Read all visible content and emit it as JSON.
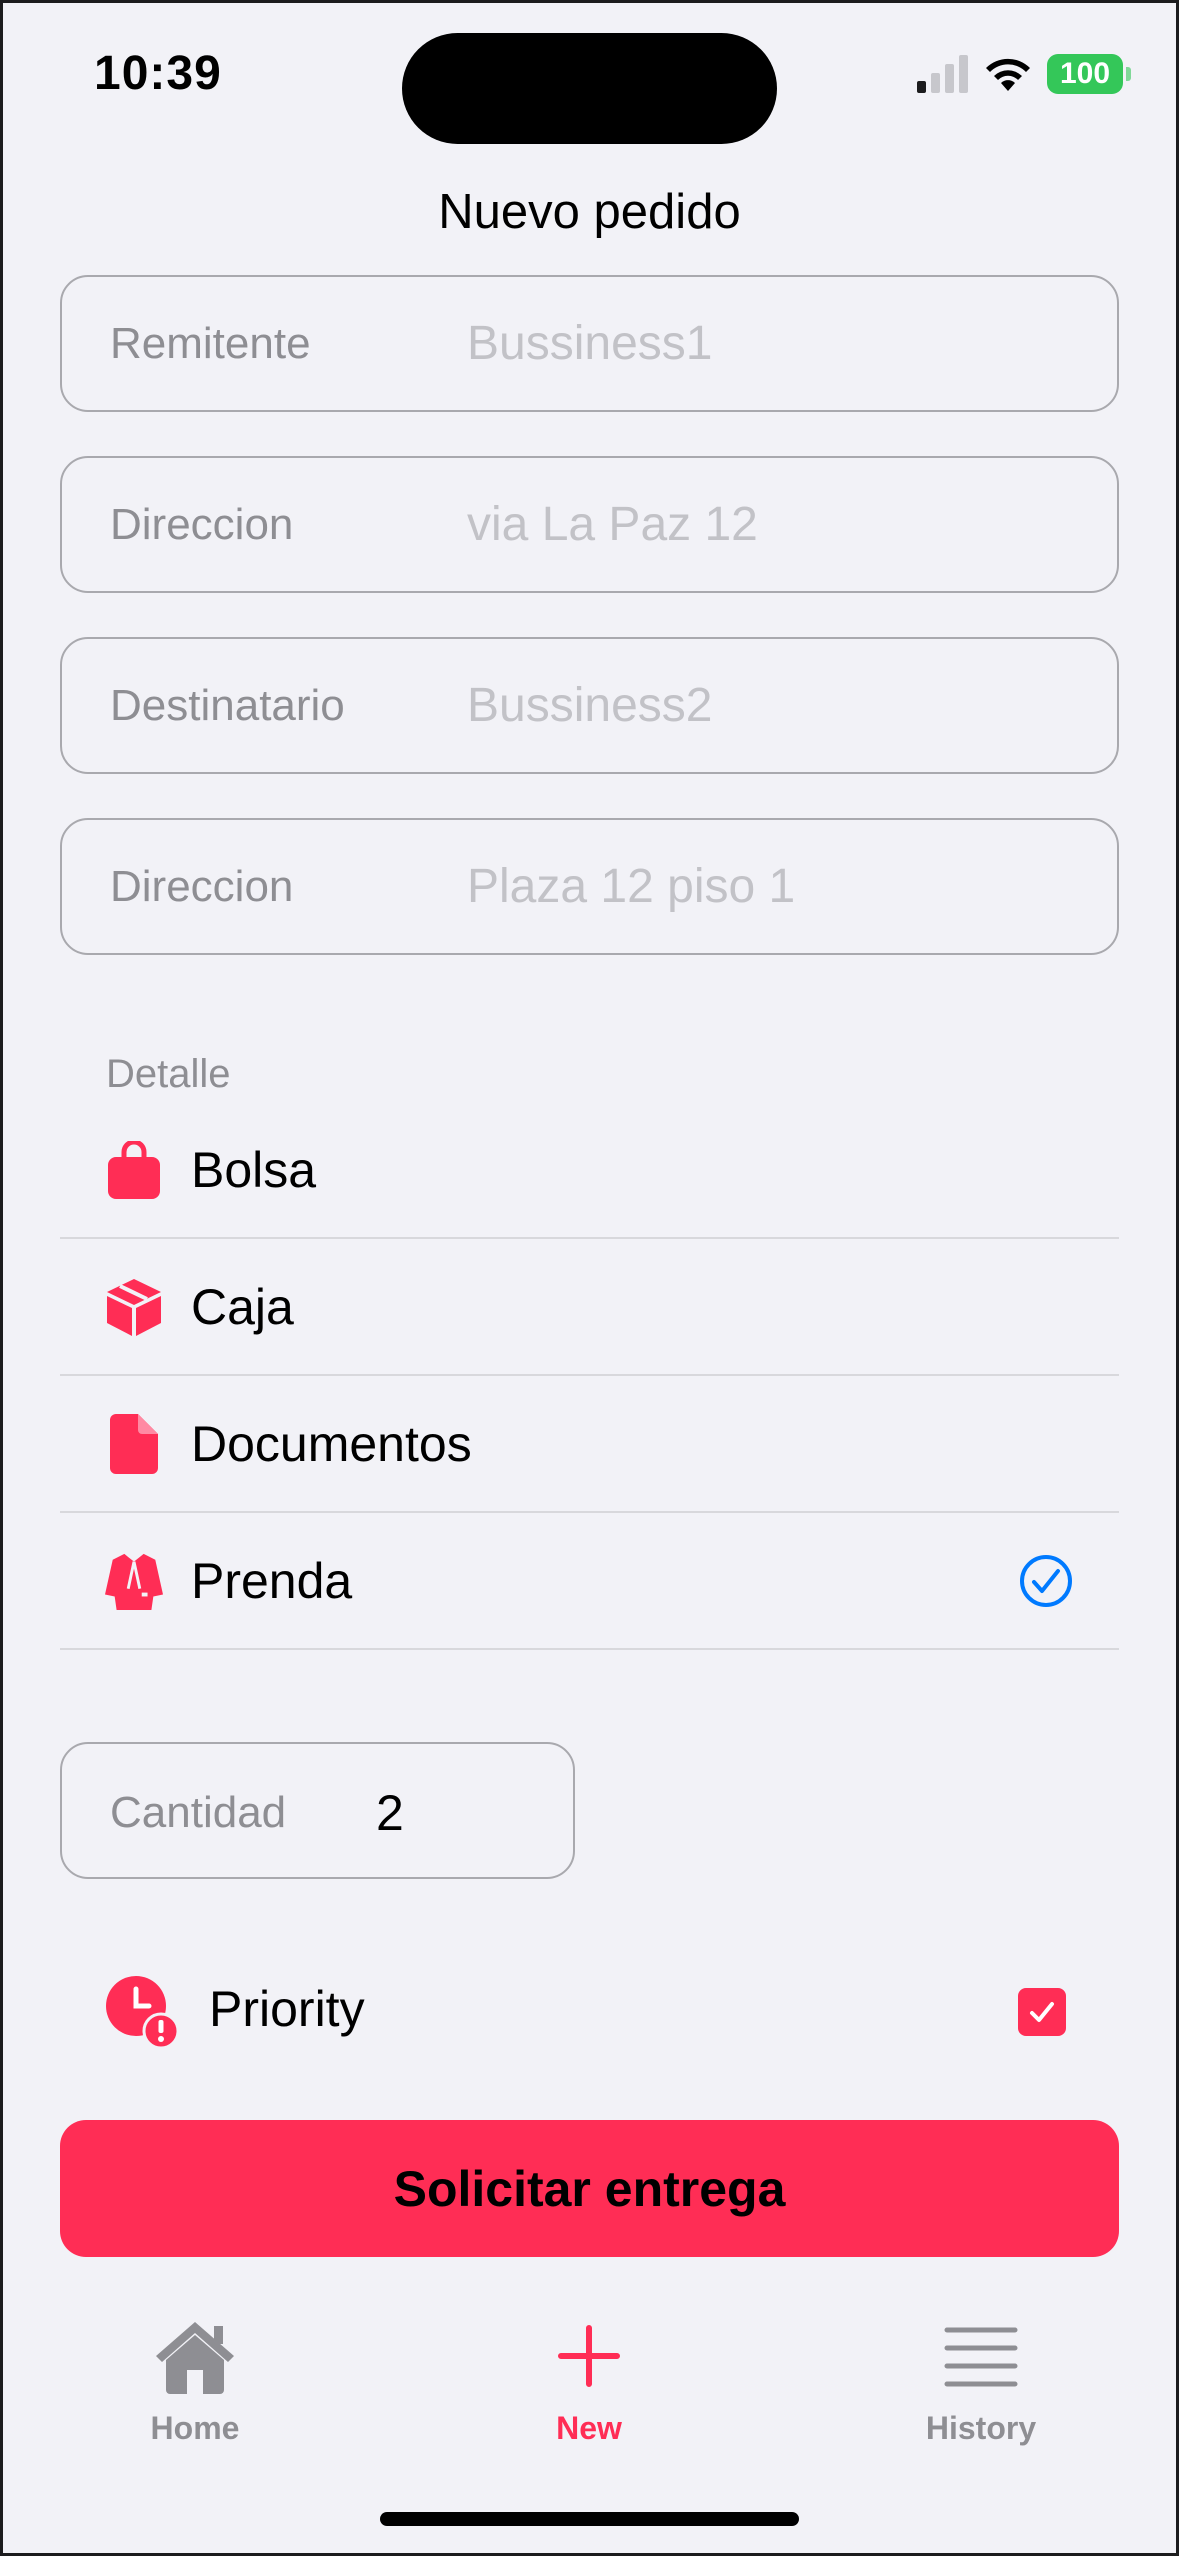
{
  "status_bar": {
    "time": "10:39",
    "battery": "100"
  },
  "nav": {
    "title": "Nuevo pedido"
  },
  "form": {
    "fields": [
      {
        "label": "Remitente",
        "placeholder": "Bussiness1"
      },
      {
        "label": "Direccion",
        "placeholder": "via La Paz 12"
      },
      {
        "label": "Destinatario",
        "placeholder": "Bussiness2"
      },
      {
        "label": "Direccion",
        "placeholder": "Plaza 12 piso 1"
      }
    ]
  },
  "detail": {
    "header": "Detalle",
    "items": [
      {
        "label": "Bolsa",
        "icon": "bag-icon",
        "selected": false
      },
      {
        "label": "Caja",
        "icon": "box-icon",
        "selected": false
      },
      {
        "label": "Documentos",
        "icon": "document-icon",
        "selected": false
      },
      {
        "label": "Prenda",
        "icon": "jacket-icon",
        "selected": true
      }
    ]
  },
  "quantity": {
    "label": "Cantidad",
    "value": "2"
  },
  "priority": {
    "label": "Priority",
    "checked": true
  },
  "submit": {
    "label": "Solicitar entrega"
  },
  "tab_bar": {
    "tabs": [
      {
        "label": "Home",
        "icon": "house-icon",
        "active": false
      },
      {
        "label": "New",
        "icon": "plus-icon",
        "active": true
      },
      {
        "label": "History",
        "icon": "list-icon",
        "active": false
      }
    ]
  },
  "colors": {
    "accent": "#ff2d55",
    "check": "#007aff",
    "battery": "#34c759",
    "background": "#f2f2f7"
  }
}
